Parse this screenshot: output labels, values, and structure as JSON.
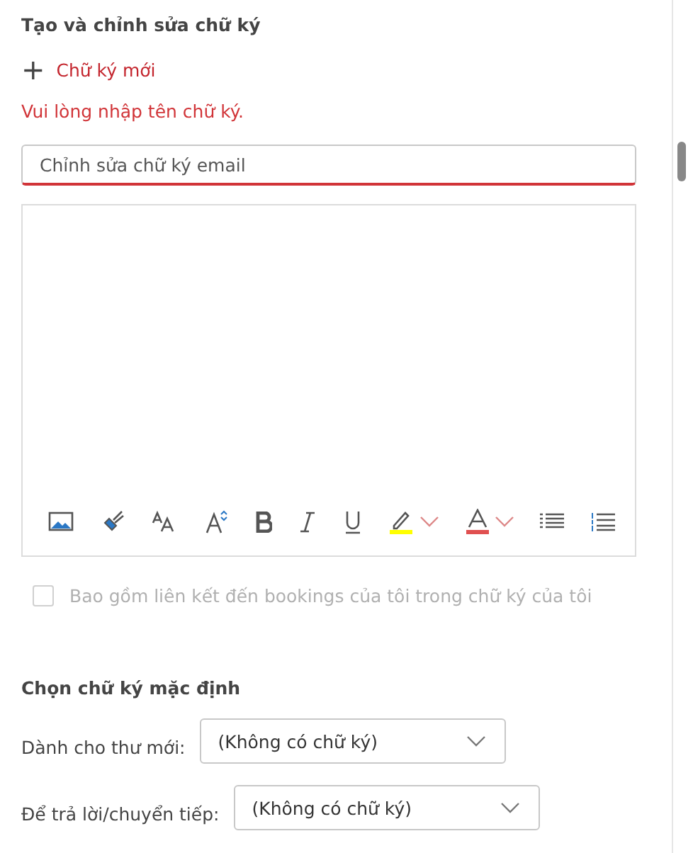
{
  "section_title": "Tạo và chỉnh sửa chữ ký",
  "new_signature": {
    "icon": "+",
    "label": "Chữ ký mới"
  },
  "error_message": "Vui lòng nhập tên chữ ký.",
  "name_field": {
    "placeholder": "Chỉnh sửa chữ ký email",
    "invalid": true
  },
  "toolbar": [
    {
      "kind": "image"
    },
    {
      "kind": "format-painter"
    },
    {
      "kind": "font-size"
    },
    {
      "kind": "grow-font"
    },
    {
      "kind": "bold"
    },
    {
      "kind": "italic"
    },
    {
      "kind": "underline"
    },
    {
      "kind": "highlight",
      "color": "#ffff00"
    },
    {
      "kind": "font-color",
      "color": "#e05050"
    },
    {
      "kind": "bullets"
    },
    {
      "kind": "numbering"
    }
  ],
  "bookings_checkbox": {
    "label": "Bao gồm liên kết đến bookings của tôi trong chữ ký của tôi",
    "checked": false,
    "disabled": true
  },
  "defaults_title": "Chọn chữ ký mặc định",
  "defaults": [
    {
      "label": "Dành cho thư mới:",
      "value": "(Không có chữ ký)"
    },
    {
      "label": "Để trả lời/chuyển tiếp:",
      "value": "(Không có chữ ký)"
    }
  ]
}
